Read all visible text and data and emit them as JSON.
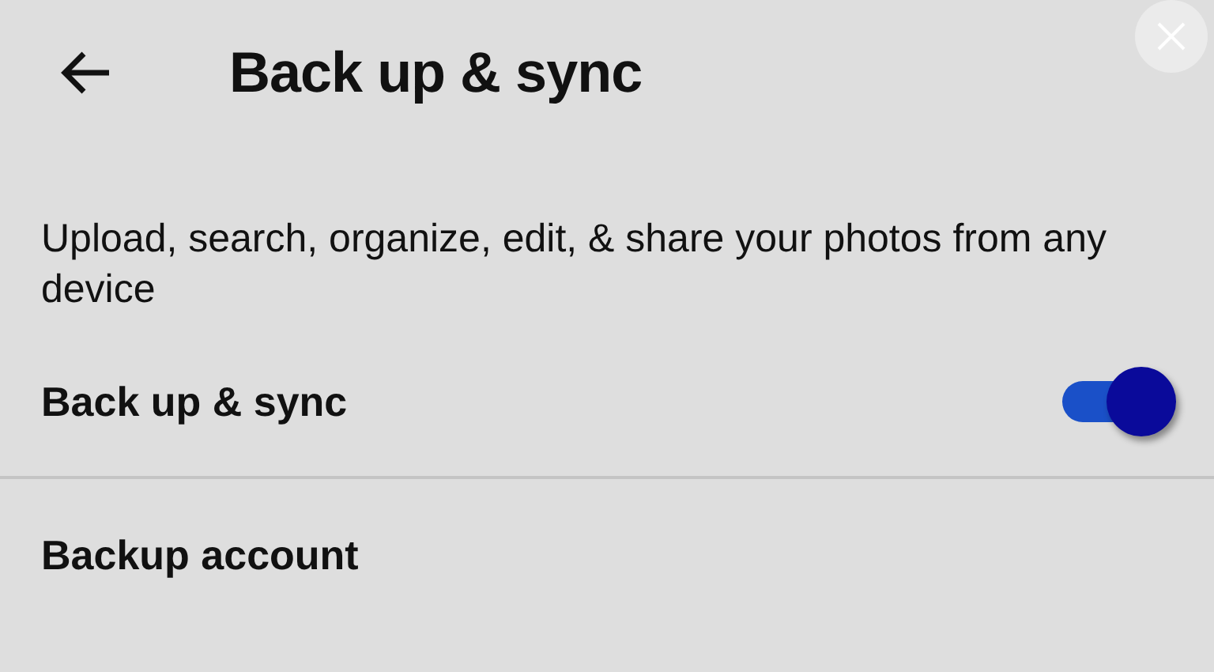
{
  "header": {
    "title": "Back up & sync"
  },
  "description": "Upload, search, organize, edit, & share your photos from any device",
  "settings": [
    {
      "kind": "toggle",
      "label": "Back up & sync",
      "on": true
    },
    {
      "kind": "link",
      "label": "Backup account"
    }
  ]
}
